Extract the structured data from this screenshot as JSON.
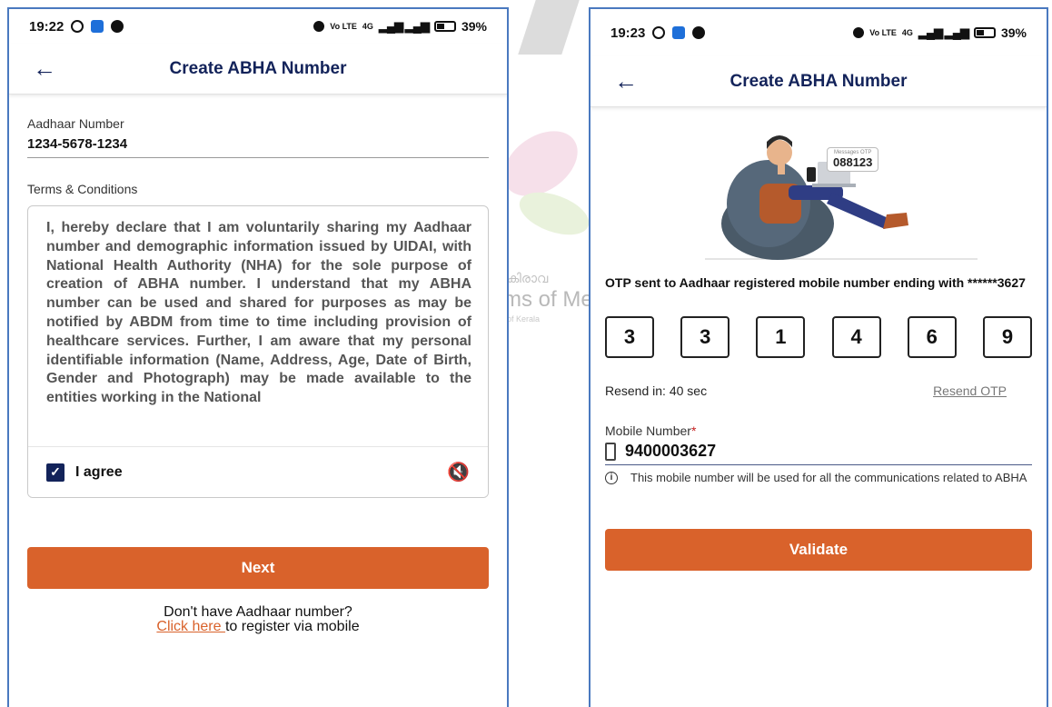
{
  "watermark": {
    "text": "ms of Med",
    "malayalam": "കിരാവ",
    "small": "of Kerala"
  },
  "left": {
    "status": {
      "time": "19:22",
      "battery": "39%",
      "net": "Vo LTE",
      "gen": "4G"
    },
    "header": {
      "title": "Create ABHA Number"
    },
    "aadhaar": {
      "label": "Aadhaar Number",
      "value": "1234-5678-1234"
    },
    "terms": {
      "label": "Terms & Conditions",
      "text": "I, hereby declare that I am voluntarily sharing my Aadhaar number and demographic information issued by UIDAI, with National Health Authority (NHA) for the sole purpose of creation of ABHA number. I understand that my ABHA number can be used and shared for purposes as may be notified by ABDM from time to time including provision of healthcare services. Further, I am aware that my personal identifiable information (Name, Address, Age, Date of Birth, Gender and Photograph) may be made available to the entities working in the National",
      "agree_label": "I agree"
    },
    "next_label": "Next",
    "no_aadhaar": "Don't have Aadhaar number?",
    "click_here": "Click here ",
    "register_via_mobile": " to register via mobile"
  },
  "right": {
    "status": {
      "time": "19:23",
      "battery": "39%",
      "net": "Vo LTE",
      "gen": "4G"
    },
    "header": {
      "title": "Create ABHA Number"
    },
    "illustration": {
      "bubble_label": "Messages OTP",
      "bubble_code": "088123"
    },
    "otp_sent": "OTP sent to Aadhaar registered mobile number ending with ******3627",
    "otp_digits": [
      "3",
      "3",
      "1",
      "4",
      "6",
      "9"
    ],
    "resend_in": "Resend in:  40 sec",
    "resend_otp": "Resend OTP",
    "mobile": {
      "label": "Mobile Number",
      "required": "*",
      "value": "9400003627"
    },
    "info": "This mobile number will be used for all the communications related to ABHA",
    "validate_label": "Validate"
  },
  "colors": {
    "primary": "#d9622b",
    "header_text": "#13235a",
    "frame": "#4a79bf"
  }
}
